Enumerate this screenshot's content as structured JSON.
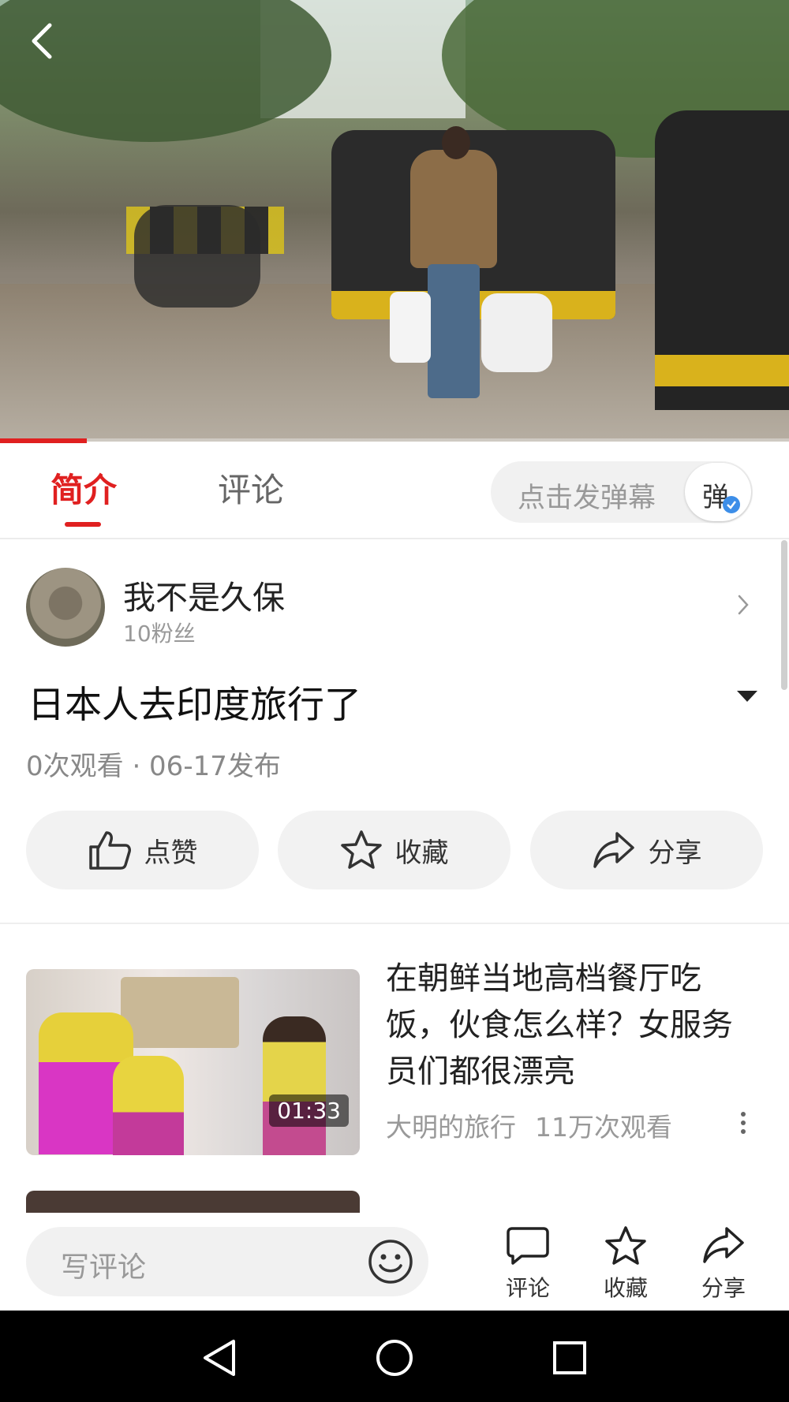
{
  "video": {
    "progress": 0.11
  },
  "tabs": {
    "intro": "简介",
    "comments": "评论"
  },
  "danmaku": {
    "placeholder": "点击发弹幕",
    "toggle_label": "弹"
  },
  "author": {
    "name": "我不是久保",
    "fans": "10粉丝"
  },
  "video_info": {
    "title": "日本人去印度旅行了",
    "meta": "0次观看 · 06-17发布"
  },
  "actions": {
    "like": "点赞",
    "favorite": "收藏",
    "share": "分享"
  },
  "recommended": [
    {
      "title": "在朝鲜当地高档餐厅吃饭，伙食怎么样？女服务员们都很漂亮",
      "author": "大明的旅行",
      "views": "11万次观看",
      "duration": "01:33"
    }
  ],
  "comment_bar": {
    "placeholder": "写评论",
    "comment": "评论",
    "favorite": "收藏",
    "share": "分享"
  },
  "colors": {
    "accent": "#e02020",
    "check_blue": "#3d8ee8"
  },
  "icons": [
    "back-arrow-icon",
    "chevron-right-icon",
    "caret-down-icon",
    "thumbs-up-icon",
    "star-icon",
    "share-arrow-icon",
    "more-dots-icon",
    "emoji-icon",
    "comment-bubble-icon",
    "nav-back-icon",
    "nav-home-icon",
    "nav-recents-icon"
  ]
}
